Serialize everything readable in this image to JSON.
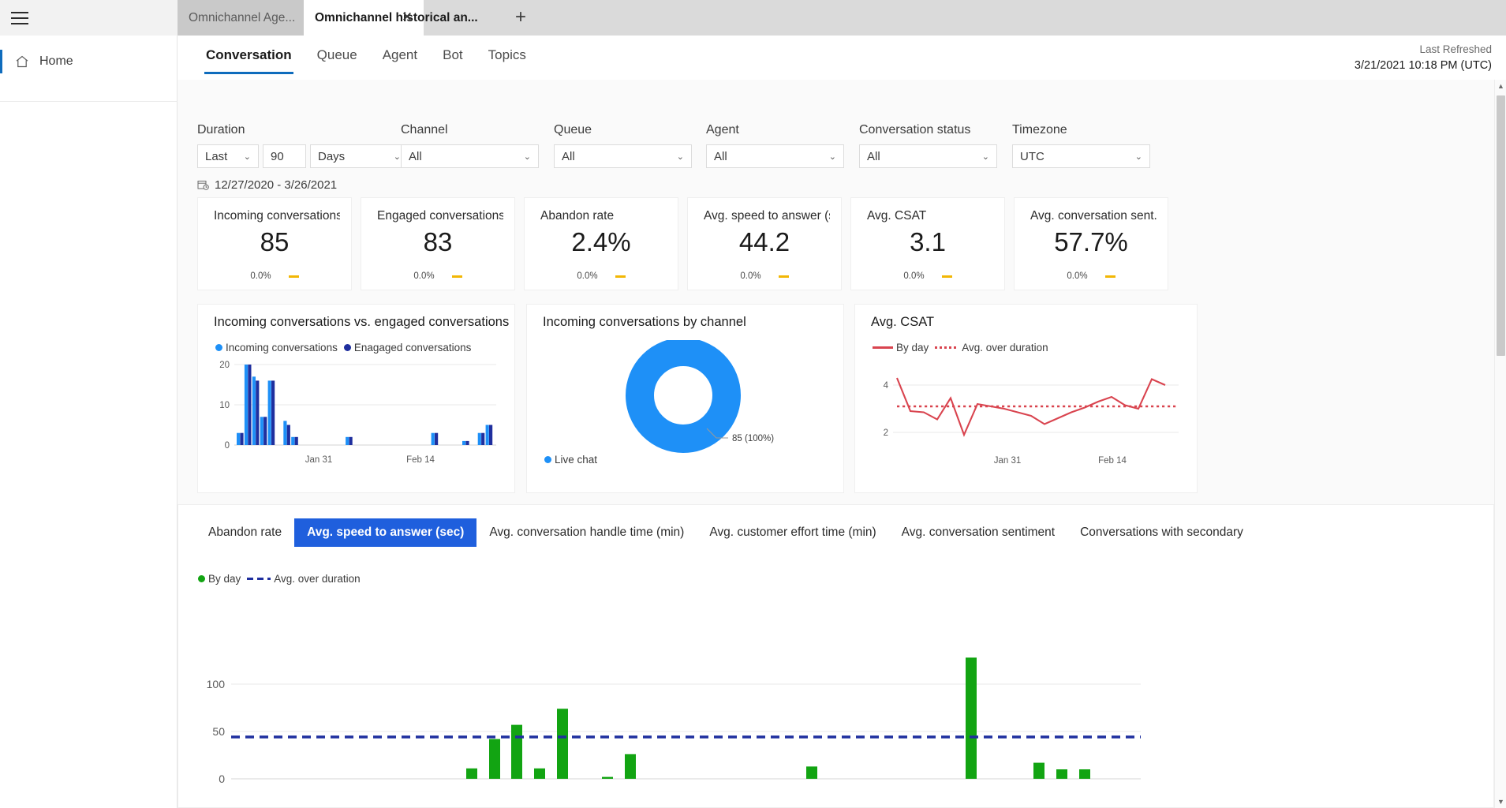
{
  "browser": {
    "menu_icon": "hamburger-icon",
    "tabs": [
      {
        "title": "Omnichannel Age...",
        "active": false
      },
      {
        "title": "Omnichannel historical an...",
        "active": true
      }
    ],
    "close_glyph": "✕",
    "new_tab_glyph": "+"
  },
  "leftnav": {
    "items": [
      {
        "label": "Home",
        "icon": "home-icon"
      }
    ]
  },
  "header": {
    "tabs": [
      {
        "label": "Conversation",
        "selected": true
      },
      {
        "label": "Queue",
        "selected": false
      },
      {
        "label": "Agent",
        "selected": false
      },
      {
        "label": "Bot",
        "selected": false
      },
      {
        "label": "Topics",
        "selected": false
      }
    ],
    "refresh_label": "Last Refreshed",
    "refresh_time": "3/21/2021 10:18 PM (UTC)"
  },
  "filters": {
    "duration": {
      "label": "Duration",
      "relative": "Last",
      "amount": "90",
      "unit": "Days"
    },
    "channel": {
      "label": "Channel",
      "value": "All"
    },
    "queue": {
      "label": "Queue",
      "value": "All"
    },
    "agent": {
      "label": "Agent",
      "value": "All"
    },
    "conversation_status": {
      "label": "Conversation status",
      "value": "All"
    },
    "timezone": {
      "label": "Timezone",
      "value": "UTC"
    },
    "date_range": "12/27/2020 - 3/26/2021",
    "calendar_icon": "calendar-icon",
    "chevron": "⌄"
  },
  "kpis": [
    {
      "title": "Incoming conversations",
      "value": "85",
      "delta": "0.0%",
      "trend": "flat"
    },
    {
      "title": "Engaged conversations",
      "value": "83",
      "delta": "0.0%",
      "trend": "flat"
    },
    {
      "title": "Abandon rate",
      "value": "2.4%",
      "delta": "0.0%",
      "trend": "flat"
    },
    {
      "title": "Avg. speed to answer (s...",
      "value": "44.2",
      "delta": "0.0%",
      "trend": "flat"
    },
    {
      "title": "Avg. CSAT",
      "value": "3.1",
      "delta": "0.0%",
      "trend": "flat"
    },
    {
      "title": "Avg. conversation sent...",
      "value": "57.7%",
      "delta": "0.0%",
      "trend": "flat"
    }
  ],
  "cards": {
    "incoming_vs_engaged": {
      "title": "Incoming conversations vs. engaged conversations"
    },
    "by_channel": {
      "title": "Incoming conversations by channel"
    },
    "csat": {
      "title": "Avg. CSAT"
    }
  },
  "bottom": {
    "tabs": [
      {
        "label": "Abandon rate",
        "selected": false
      },
      {
        "label": "Avg. speed to answer (sec)",
        "selected": true
      },
      {
        "label": "Avg. conversation handle time (min)",
        "selected": false
      },
      {
        "label": "Avg. customer effort time (min)",
        "selected": false
      },
      {
        "label": "Avg. conversation sentiment",
        "selected": false
      },
      {
        "label": "Conversations with secondary",
        "selected": false
      }
    ]
  },
  "colors": {
    "accent_blue": "#0f6cbd",
    "tab_blue": "#1f5fdd",
    "light_blue": "#1e90f7",
    "dark_blue": "#1f2f9e",
    "red": "#d9444f",
    "green": "#12a412",
    "amber": "#f2b705"
  },
  "chart_data": [
    {
      "id": "incoming-vs-engaged",
      "type": "bar",
      "title": "Incoming conversations vs. engaged conversations",
      "xlabel": "",
      "ylabel": "",
      "ylim": [
        0,
        22
      ],
      "yticks": [
        0,
        10,
        20
      ],
      "grid": true,
      "legend_position": "top-left",
      "xtick_labels": [
        "Jan 31",
        "Feb 14"
      ],
      "xtick_indices": [
        10,
        24
      ],
      "x": [
        0,
        1,
        2,
        3,
        4,
        5,
        6,
        7,
        8,
        9,
        10,
        11,
        12,
        13,
        14,
        15,
        16,
        17,
        18,
        19,
        20,
        21,
        22,
        23,
        24,
        25,
        26,
        27,
        28,
        29,
        30,
        31,
        32
      ],
      "series": [
        {
          "name": "Incoming conversations",
          "color": "#1e90f7",
          "values": [
            3,
            20,
            17,
            7,
            16,
            0,
            6,
            2,
            0,
            0,
            0,
            0,
            0,
            0,
            2,
            0,
            0,
            0,
            0,
            0,
            0,
            0,
            0,
            0,
            0,
            3,
            0,
            0,
            0,
            1,
            0,
            3,
            5
          ]
        },
        {
          "name": "Enagaged conversations",
          "color": "#1f2f9e",
          "values": [
            3,
            20,
            16,
            7,
            16,
            0,
            5,
            2,
            0,
            0,
            0,
            0,
            0,
            0,
            2,
            0,
            0,
            0,
            0,
            0,
            0,
            0,
            0,
            0,
            0,
            3,
            0,
            0,
            0,
            1,
            0,
            3,
            5
          ]
        }
      ]
    },
    {
      "id": "incoming-by-channel",
      "type": "pie",
      "subtype": "donut",
      "title": "Incoming conversations by channel",
      "labels": [
        "Live chat"
      ],
      "values": [
        85
      ],
      "percentages": [
        "100%"
      ],
      "colors": [
        "#1e90f7"
      ],
      "callout": "85 (100%)",
      "legend_position": "bottom-left"
    },
    {
      "id": "avg-csat",
      "type": "line",
      "title": "Avg. CSAT",
      "ylim": [
        1.6,
        4.6
      ],
      "yticks": [
        2,
        4
      ],
      "grid": true,
      "legend_position": "top-left",
      "xtick_labels": [
        "Jan 31",
        "Feb 14"
      ],
      "xtick_indices": [
        8,
        16
      ],
      "series": [
        {
          "name": "By day",
          "color": "#d9444f",
          "style": "solid",
          "x": [
            0,
            1,
            2,
            3,
            4,
            5,
            6,
            7,
            8,
            9,
            10,
            11,
            12,
            13,
            14,
            15,
            16,
            17,
            18,
            19,
            20
          ],
          "values": [
            4.3,
            2.9,
            2.85,
            2.55,
            3.45,
            1.9,
            3.2,
            3.1,
            3.0,
            2.85,
            2.7,
            2.35,
            2.6,
            2.85,
            3.05,
            3.3,
            3.5,
            3.15,
            3.0,
            4.25,
            4.0
          ]
        },
        {
          "name": "Avg. over duration",
          "color": "#d9444f",
          "style": "dotted",
          "constant": 3.1
        }
      ]
    },
    {
      "id": "avg-speed-to-answer",
      "type": "bar",
      "title": "Avg. speed to answer (sec)",
      "ylim": [
        0,
        135
      ],
      "yticks": [
        0,
        50,
        100
      ],
      "grid": true,
      "legend_position": "top-left",
      "legend": [
        "By day",
        "Avg. over duration"
      ],
      "series": [
        {
          "name": "By day",
          "color": "#12a412",
          "x": [
            0,
            1,
            2,
            3,
            4,
            5,
            6,
            7,
            8,
            9,
            10,
            11,
            12,
            13,
            14,
            15,
            16,
            17,
            18,
            19,
            20,
            21,
            22,
            23,
            24,
            25,
            26,
            27,
            28,
            29,
            30,
            31,
            32,
            33,
            34,
            35,
            36,
            37,
            38,
            39
          ],
          "values": [
            0,
            0,
            0,
            0,
            0,
            0,
            0,
            0,
            0,
            0,
            0,
            0,
            0,
            11,
            42,
            57,
            11,
            74,
            0,
            2,
            26,
            0,
            0,
            0,
            0,
            0,
            0,
            13,
            0,
            0,
            0,
            0,
            0,
            0,
            128,
            0,
            0,
            17,
            10,
            10
          ]
        },
        {
          "name": "Avg. over duration",
          "color": "#1f2f9e",
          "style": "dashed",
          "constant": 44.2
        }
      ]
    }
  ]
}
